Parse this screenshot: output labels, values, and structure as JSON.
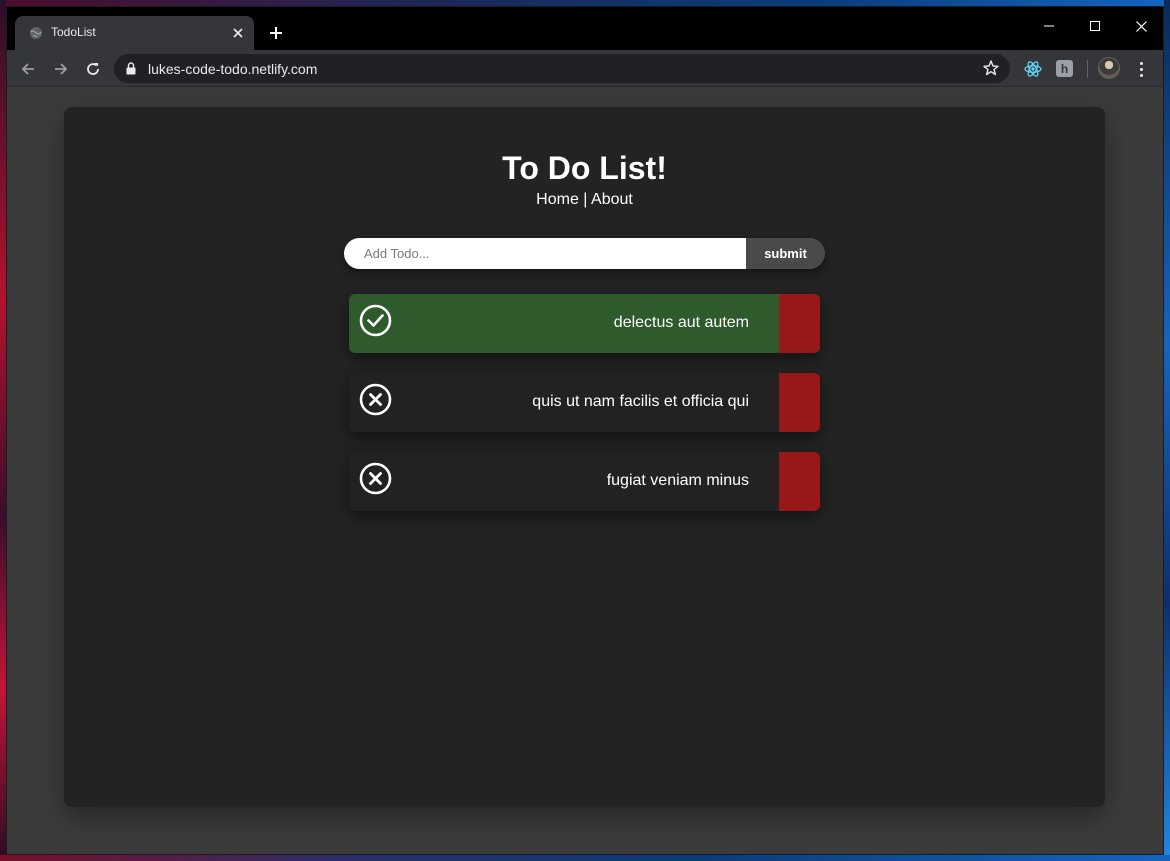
{
  "browser": {
    "tab_title": "TodoList",
    "url": "lukes-code-todo.netlify.com",
    "icons": {
      "favicon": "globe-icon",
      "close_tab": "close-icon",
      "new_tab": "plus-icon",
      "back": "arrow-left-icon",
      "forward": "arrow-right-icon",
      "reload": "reload-icon",
      "lock": "lock-icon",
      "bookmark": "star-icon",
      "menu": "kebab-menu-icon"
    },
    "extensions": [
      "react-devtools-icon",
      "h-extension-icon"
    ],
    "ext_h_label": "h"
  },
  "page": {
    "title": "To Do List!",
    "nav": {
      "home": "Home",
      "separator": " | ",
      "about": "About"
    },
    "form": {
      "placeholder": "Add Todo...",
      "value": "",
      "submit_label": "submit"
    },
    "todos": [
      {
        "text": "delectus aut autem",
        "completed": true,
        "status_icon": "check-circle-icon"
      },
      {
        "text": "quis ut nam facilis et officia qui",
        "completed": false,
        "status_icon": "x-circle-icon"
      },
      {
        "text": "fugiat veniam minus",
        "completed": false,
        "status_icon": "x-circle-icon"
      }
    ],
    "colors": {
      "completed_bg": "#2e5a2c",
      "pending_bg": "#222222",
      "delete_bg": "#961818",
      "card_bg": "#232323"
    }
  }
}
